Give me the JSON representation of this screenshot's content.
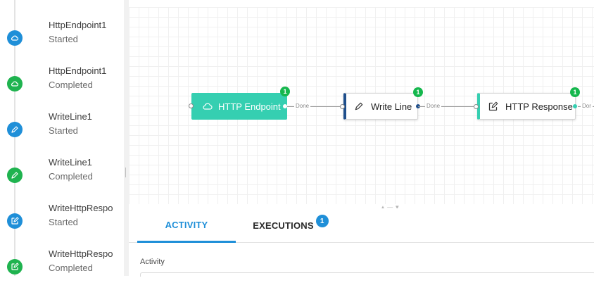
{
  "timeline": {
    "events": [
      {
        "name": "HttpEndpoint1",
        "status": "Started",
        "icon": "cloud-icon",
        "color": "#1f8fd8"
      },
      {
        "name": "HttpEndpoint1",
        "status": "Completed",
        "icon": "cloud-icon",
        "color": "#1fb34f"
      },
      {
        "name": "WriteLine1",
        "status": "Started",
        "icon": "pencil-icon",
        "color": "#1f8fd8"
      },
      {
        "name": "WriteLine1",
        "status": "Completed",
        "icon": "pencil-icon",
        "color": "#1fb34f"
      },
      {
        "name": "WriteHttpRespo",
        "status": "Started",
        "icon": "edit-square-icon",
        "color": "#1f8fd8"
      },
      {
        "name": "WriteHttpRespo",
        "status": "Completed",
        "icon": "edit-square-icon",
        "color": "#1fb34f"
      }
    ]
  },
  "designer": {
    "nodes": [
      {
        "label": "HTTP Endpoint",
        "icon": "cloud-icon",
        "badge": "1"
      },
      {
        "label": "Write Line",
        "icon": "pencil-icon",
        "badge": "1"
      },
      {
        "label": "HTTP Response",
        "icon": "edit-square-icon",
        "badge": "1"
      }
    ],
    "connections": [
      {
        "label": "Done"
      },
      {
        "label": "Done"
      },
      {
        "label": "Dor"
      }
    ]
  },
  "panel": {
    "tabs": [
      {
        "label": "ACTIVITY",
        "active": true
      },
      {
        "label": "EXECUTIONS",
        "badge": "1"
      }
    ],
    "activity_label": "Activity"
  },
  "colors": {
    "accent_blue": "#1f8fd8",
    "success_green": "#15b74d",
    "endpoint_teal": "#35cfb1",
    "writeline_border": "#1f4f8c"
  }
}
